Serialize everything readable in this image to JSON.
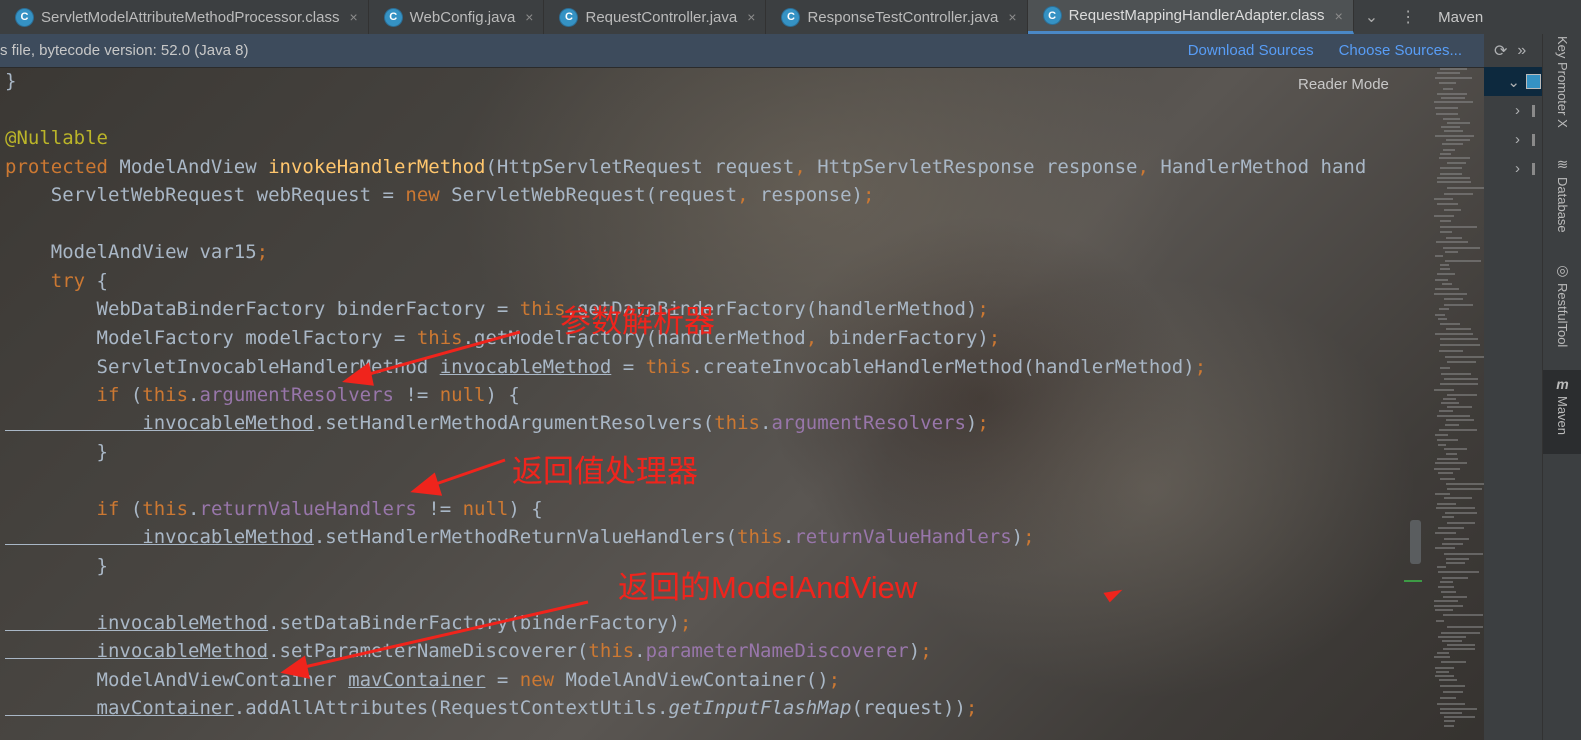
{
  "tabs": [
    {
      "label": "ServletModelAttributeMethodProcessor.class",
      "active": false
    },
    {
      "label": "WebConfig.java",
      "active": false
    },
    {
      "label": "RequestController.java",
      "active": false
    },
    {
      "label": "ResponseTestController.java",
      "active": false
    },
    {
      "label": "RequestMappingHandlerAdapter.class",
      "active": true
    }
  ],
  "tab_close": "×",
  "tab_icon_letter": "C",
  "tab_tools": {
    "chevron": "⌄",
    "more": "⋮"
  },
  "maven": {
    "title": "Maven",
    "toolbar_refresh": "⟳",
    "toolbar_more": "»"
  },
  "banner": {
    "message": "s file, bytecode version: 52.0 (Java 8)",
    "download_sources": "Download Sources",
    "choose_sources": "Choose Sources..."
  },
  "editor": {
    "reader_mode": "Reader Mode"
  },
  "code": {
    "l1": "}",
    "l2_annotation": "@Nullable",
    "l3": {
      "kw": "protected",
      "type": " ModelAndView ",
      "fn": "invokeHandlerMethod",
      "rest": "(HttpServletRequest request",
      "comma1": ",",
      "rest2": " HttpServletResponse response",
      "comma2": ",",
      "rest3": " HandlerMethod hand"
    },
    "l4": {
      "a": "    ServletWebRequest webRequest = ",
      "kw": "new",
      "b": " ServletWebRequest(request",
      "comma": ",",
      "c": " response)",
      "semi": ";"
    },
    "l5": {
      "a": "    ModelAndView var15",
      "semi": ";"
    },
    "l6": {
      "kw": "    try",
      "b": " {"
    },
    "l7": {
      "a": "        WebDataBinderFactory binderFactory = ",
      "kw": "this",
      "b": ".getDataBinderFactory(handlerMethod)",
      "semi": ";"
    },
    "l8": {
      "a": "        ModelFactory modelFactory = ",
      "kw": "this",
      "b": ".getModelFactory(handlerMethod",
      "comma": ",",
      "c": " binderFactory)",
      "semi": ";"
    },
    "l9": {
      "a": "        ServletInvocableHandlerMethod ",
      "var": "invocableMethod",
      "b": " = ",
      "kw": "this",
      "c": ".createInvocableHandlerMethod(handlerMethod)",
      "semi": ";"
    },
    "l10": {
      "kw": "        if",
      "a": " (",
      "kw2": "this",
      "dot": ".",
      "fld": "argumentResolvers",
      "b": " != ",
      "kw3": "null",
      "c": ") {"
    },
    "l11": {
      "var": "            invocableMethod",
      "a": ".setHandlerMethodArgumentResolvers(",
      "kw": "this",
      "dot": ".",
      "fld": "argumentResolvers",
      "b": ")",
      "semi": ";"
    },
    "l12": "        }",
    "l13": {
      "kw": "        if",
      "a": " (",
      "kw2": "this",
      "dot": ".",
      "fld": "returnValueHandlers",
      "b": " != ",
      "kw3": "null",
      "c": ") {"
    },
    "l14": {
      "var": "            invocableMethod",
      "a": ".setHandlerMethodReturnValueHandlers(",
      "kw": "this",
      "dot": ".",
      "fld": "returnValueHandlers",
      "b": ")",
      "semi": ";"
    },
    "l15": "        }",
    "l16": {
      "var": "        invocableMethod",
      "a": ".setDataBinderFactory(binderFactory)",
      "semi": ";"
    },
    "l17": {
      "var": "        invocableMethod",
      "a": ".setParameterNameDiscoverer(",
      "kw": "this",
      "dot": ".",
      "fld": "parameterNameDiscoverer",
      "b": ")",
      "semi": ";"
    },
    "l18": {
      "a": "        ModelAndViewContainer ",
      "var": "mavContainer",
      "b": " = ",
      "kw": "new",
      "c": " ModelAndViewContainer()",
      "semi": ";"
    },
    "l19": {
      "var": "        mavContainer",
      "a": ".addAllAttributes(RequestContextUtils.",
      "it": "getInputFlashMap",
      "b": "(request))",
      "semi": ";"
    }
  },
  "annotations": {
    "arg_resolver": "参数解析器",
    "return_handler": "返回值处理器",
    "return_mav": "返回的ModelAndView"
  },
  "tool_stripe": [
    {
      "label": "Key Promoter X",
      "icon": "⌨"
    },
    {
      "label": "Database",
      "icon": "≋"
    },
    {
      "label": "RestfulTool",
      "icon": "◎"
    },
    {
      "label": "Maven",
      "icon": "m"
    }
  ],
  "colors": {
    "annotation_red": "#f0241c",
    "keyword": "#cc7832",
    "field": "#9876aa",
    "function": "#ffc66d",
    "link": "#589df6"
  }
}
